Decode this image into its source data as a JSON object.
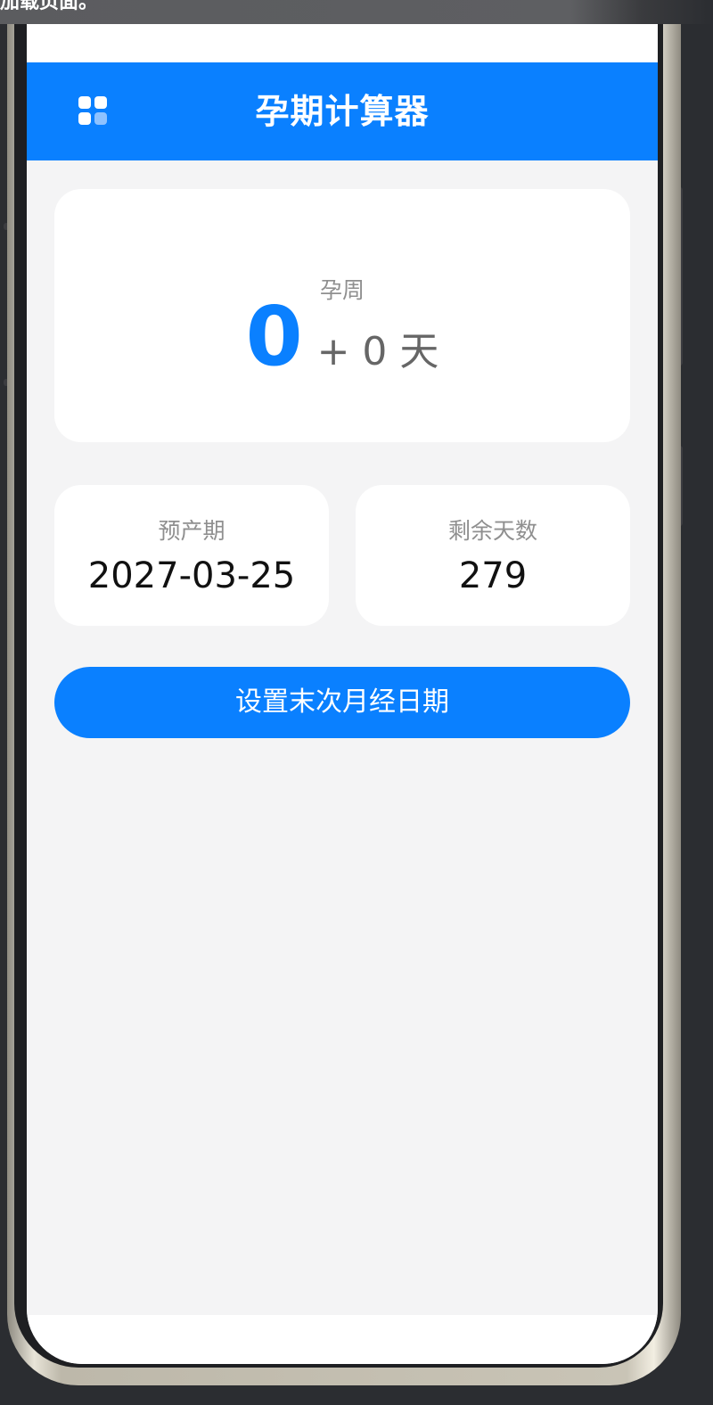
{
  "notification": {
    "text": "加载页面。"
  },
  "app": {
    "title": "孕期计算器"
  },
  "pregnancy_week": {
    "label": "孕周",
    "weeks": "0",
    "extra_days_text": "+ 0 天"
  },
  "due_date": {
    "label": "预产期",
    "value": "2027-03-25"
  },
  "remaining_days": {
    "label": "剩余天数",
    "value": "279"
  },
  "actions": {
    "set_lmp_label": "设置末次月经日期"
  },
  "colors": {
    "primary": "#0a80ff",
    "background": "#f4f4f5",
    "card": "#ffffff",
    "label": "#8f8f8f"
  },
  "icons": {
    "menu": "grid-icon"
  }
}
